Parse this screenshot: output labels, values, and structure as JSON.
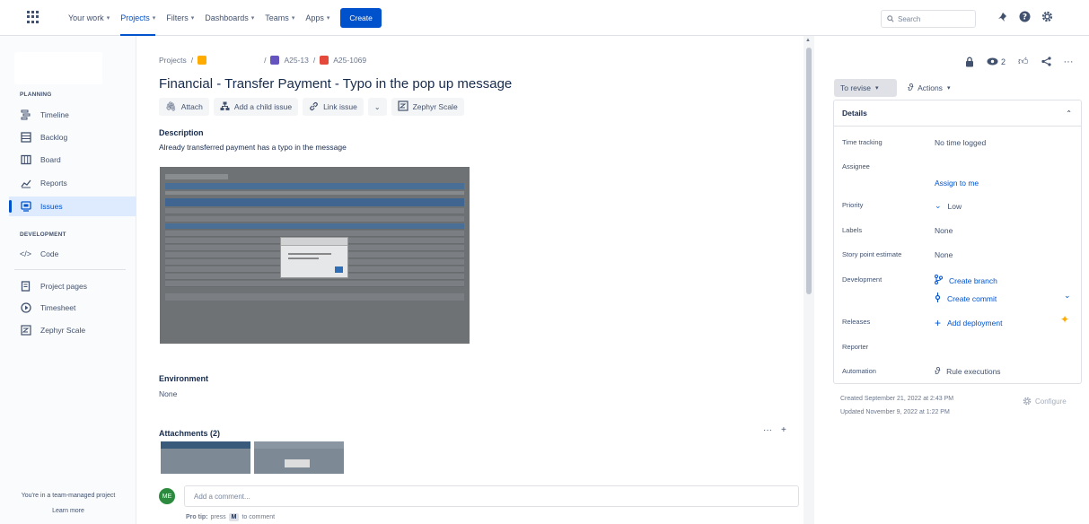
{
  "topnav": {
    "items": [
      {
        "label": "Your work",
        "active": false
      },
      {
        "label": "Projects",
        "active": true
      },
      {
        "label": "Filters",
        "active": false
      },
      {
        "label": "Dashboards",
        "active": false
      },
      {
        "label": "Teams",
        "active": false
      },
      {
        "label": "Apps",
        "active": false
      }
    ],
    "create_label": "Create",
    "search_placeholder": "Search",
    "accent": "#0052cc"
  },
  "sidebar": {
    "planning_label": "PLANNING",
    "planning_items": [
      {
        "label": "Timeline",
        "icon": "timeline-icon"
      },
      {
        "label": "Backlog",
        "icon": "backlog-icon"
      },
      {
        "label": "Board",
        "icon": "board-icon"
      },
      {
        "label": "Reports",
        "icon": "reports-icon"
      },
      {
        "label": "Issues",
        "icon": "issues-icon",
        "active": true
      }
    ],
    "development_label": "DEVELOPMENT",
    "development_items": [
      {
        "label": "Code",
        "icon": "code-icon"
      }
    ],
    "other_items": [
      {
        "label": "Project pages",
        "icon": "page-icon"
      },
      {
        "label": "Timesheet",
        "icon": "timesheet-icon"
      },
      {
        "label": "Zephyr Scale",
        "icon": "zephyr-icon"
      }
    ],
    "footer_text": "You're in a team-managed project",
    "footer_link": "Learn more"
  },
  "issue": {
    "breadcrumb": {
      "root": "Projects",
      "parent": "A25-13",
      "key": "A25-1069"
    },
    "title": "Financial - Transfer Payment - Typo in the pop up message",
    "actions": {
      "attach": "Attach",
      "child": "Add a child issue",
      "link": "Link issue",
      "zephyr": "Zephyr Scale"
    },
    "description_label": "Description",
    "description_text": "Already transferred payment has a typo in the message",
    "environment_label": "Environment",
    "environment_value": "None",
    "attachments_label": "Attachments (2)",
    "comment": {
      "avatar_initials": "ME",
      "placeholder": "Add a comment...",
      "protip_prefix": "Pro tip:",
      "protip_press": "press",
      "protip_key": "M",
      "protip_suffix": "to comment"
    }
  },
  "right": {
    "watchers_count": "2",
    "status_label": "To revise",
    "actions_label": "Actions",
    "details_label": "Details",
    "fields": {
      "time_tracking_label": "Time tracking",
      "time_tracking_value": "No time logged",
      "assignee_label": "Assignee",
      "assign_to_me": "Assign to me",
      "priority_label": "Priority",
      "priority_value": "Low",
      "labels_label": "Labels",
      "labels_value": "None",
      "story_points_label": "Story point estimate",
      "story_points_value": "None",
      "development_label": "Development",
      "create_branch": "Create branch",
      "create_commit": "Create commit",
      "releases_label": "Releases",
      "add_deployment": "Add deployment",
      "reporter_label": "Reporter",
      "automation_label": "Automation",
      "rule_executions": "Rule executions"
    },
    "created": "Created September 21, 2022 at 2:43 PM",
    "updated": "Updated November 9, 2022 at 1:22 PM",
    "configure_label": "Configure"
  }
}
